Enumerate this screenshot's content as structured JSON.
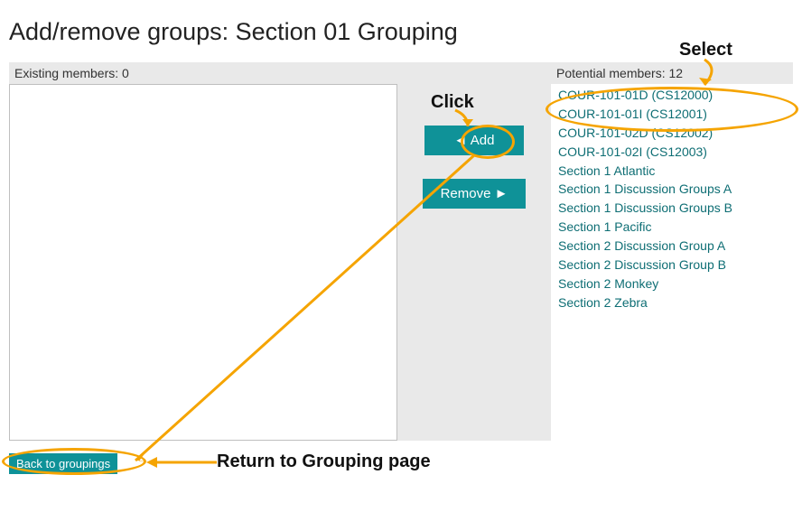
{
  "header": {
    "title": "Add/remove groups: Section 01 Grouping"
  },
  "existing": {
    "label": "Existing members: 0",
    "items": []
  },
  "potential": {
    "label": "Potential members: 12",
    "items": [
      "COUR-101-01D (CS12000)",
      "COUR-101-01I (CS12001)",
      "COUR-101-02D (CS12002)",
      "COUR-101-02I (CS12003)",
      "Section 1 Atlantic",
      "Section 1 Discussion Groups A",
      "Section 1 Discussion Groups B",
      "Section 1 Pacific",
      "Section 2 Discussion Group A",
      "Section 2 Discussion Group B",
      "Section 2 Monkey",
      "Section 2 Zebra"
    ]
  },
  "buttons": {
    "add": "◄ Add",
    "remove": "Remove ►",
    "back": "Back to groupings"
  },
  "annotations": {
    "select": "Select",
    "click": "Click",
    "return": "Return to Grouping page"
  }
}
